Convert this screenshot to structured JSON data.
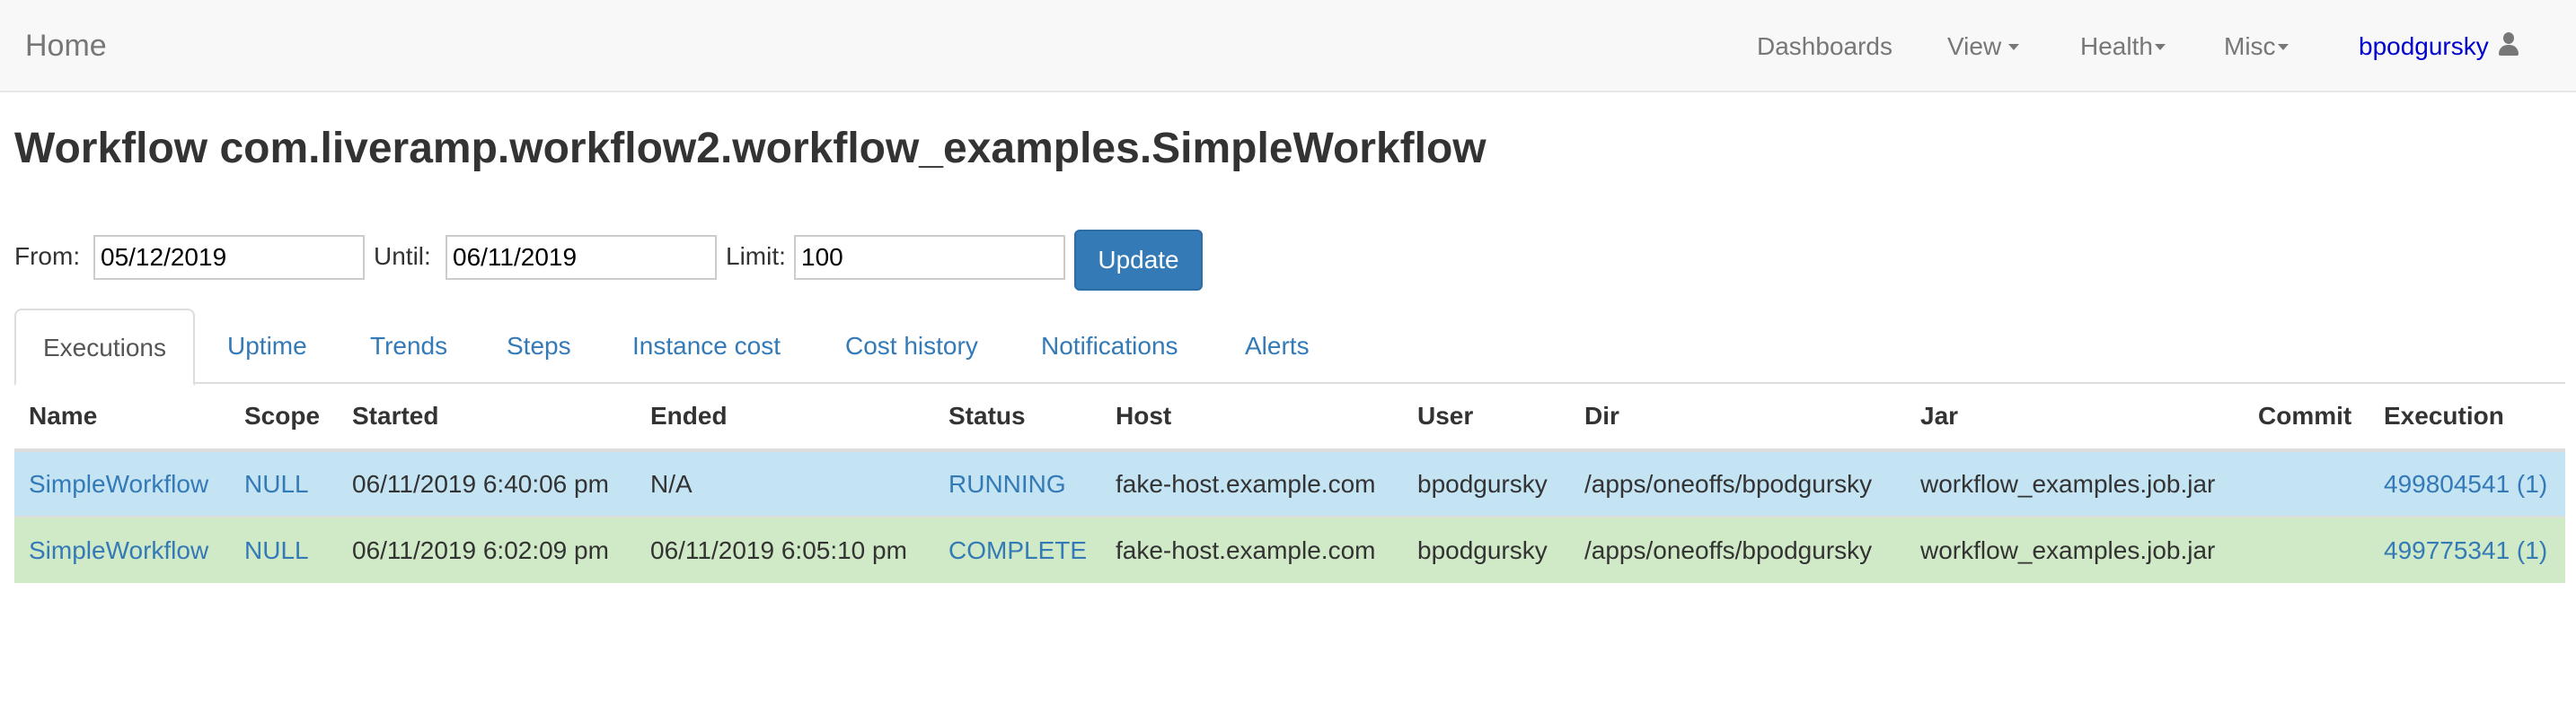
{
  "navbar": {
    "brand": "Home",
    "items": [
      {
        "label": "Dashboards"
      },
      {
        "label": "View"
      },
      {
        "label": "Health"
      },
      {
        "label": "Misc"
      }
    ],
    "user": "bpodgursky"
  },
  "page": {
    "title_prefix": "Workflow",
    "title_name": "com.liveramp.workflow2.workflow_examples.SimpleWorkflow"
  },
  "filters": {
    "from_label": "From:",
    "from_value": "05/12/2019",
    "until_label": "Until:",
    "until_value": "06/11/2019",
    "limit_label": "Limit:",
    "limit_value": "100",
    "update_label": "Update"
  },
  "tabs": [
    {
      "label": "Executions",
      "active": true
    },
    {
      "label": "Uptime"
    },
    {
      "label": "Trends"
    },
    {
      "label": "Steps"
    },
    {
      "label": "Instance cost"
    },
    {
      "label": "Cost history"
    },
    {
      "label": "Notifications"
    },
    {
      "label": "Alerts"
    }
  ],
  "table": {
    "columns": [
      "Name",
      "Scope",
      "Started",
      "Ended",
      "Status",
      "Host",
      "User",
      "Dir",
      "Jar",
      "Commit",
      "Execution"
    ],
    "rows": [
      {
        "name": "SimpleWorkflow",
        "scope": "NULL",
        "started": "06/11/2019 6:40:06 pm",
        "ended": "N/A",
        "status": "RUNNING",
        "host": "fake-host.example.com",
        "user": "bpodgursky",
        "dir": "/apps/oneoffs/bpodgursky",
        "jar": "workflow_examples.job.jar",
        "commit": "",
        "execution": "499804541 (1)",
        "row_color": "#c4e3f3"
      },
      {
        "name": "SimpleWorkflow",
        "scope": "NULL",
        "started": "06/11/2019 6:02:09 pm",
        "ended": "06/11/2019 6:05:10 pm",
        "status": "COMPLETE",
        "host": "fake-host.example.com",
        "user": "bpodgursky",
        "dir": "/apps/oneoffs/bpodgursky",
        "jar": "workflow_examples.job.jar",
        "commit": "",
        "execution": "499775341 (1)",
        "row_color": "#d0e9c6"
      }
    ]
  },
  "colors": {
    "link": "#337ab7",
    "primary_button": "#337ab7",
    "navbar_bg": "#f8f8f8",
    "user_link": "#0000cc"
  }
}
